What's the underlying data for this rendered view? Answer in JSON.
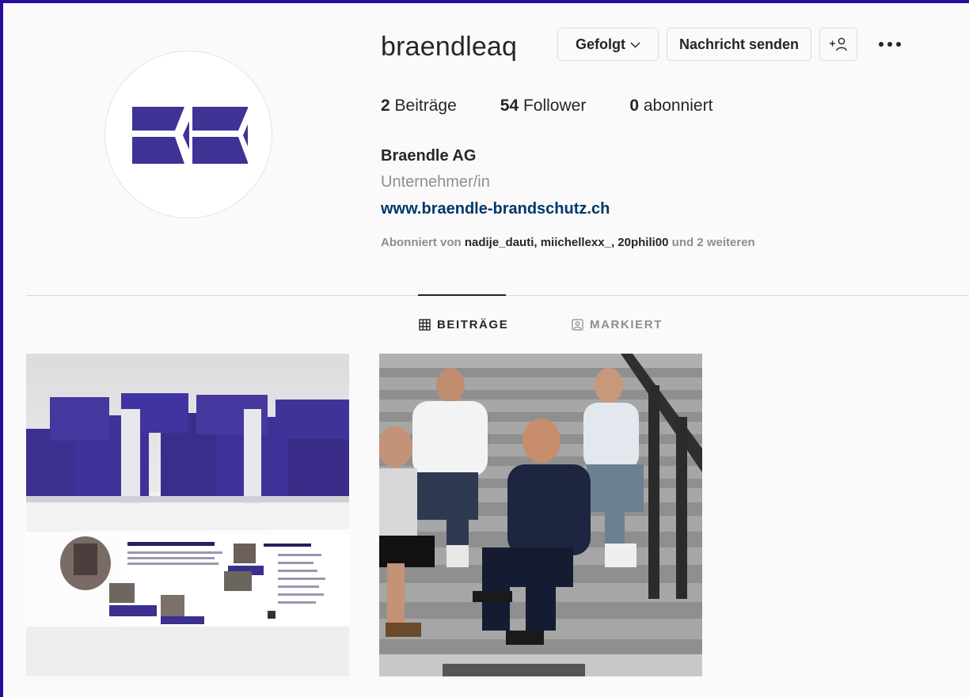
{
  "profile": {
    "username": "braendleaq",
    "full_name": "Braendle AG",
    "category": "Unternehmer/in",
    "website": "www.braendle-brandschutz.ch"
  },
  "actions": {
    "followed_label": "Gefolgt",
    "message_label": "Nachricht senden",
    "suggest_icon": "add-person-icon",
    "more_icon": "more-dots-icon"
  },
  "stats": {
    "posts_count": "2",
    "posts_label": "Beiträge",
    "followers_count": "54",
    "followers_label": "Follower",
    "following_count": "0",
    "following_label": "abonniert"
  },
  "followed_by": {
    "prefix": "Abonniert von",
    "users": [
      "nadije_dauti",
      "miichellexx_",
      "20phili00"
    ],
    "suffix": "und 2 weiteren"
  },
  "tabs": [
    {
      "label": "BEITRÄGE",
      "icon": "grid-icon",
      "active": true
    },
    {
      "label": "MARKIERT",
      "icon": "tagged-icon",
      "active": false
    }
  ],
  "posts": [
    {
      "description_icon": "brochure-photo"
    },
    {
      "description_icon": "team-photo"
    }
  ],
  "colors": {
    "brand_purple": "#3d3496",
    "link": "#00376b",
    "muted": "#8e8e8e"
  }
}
